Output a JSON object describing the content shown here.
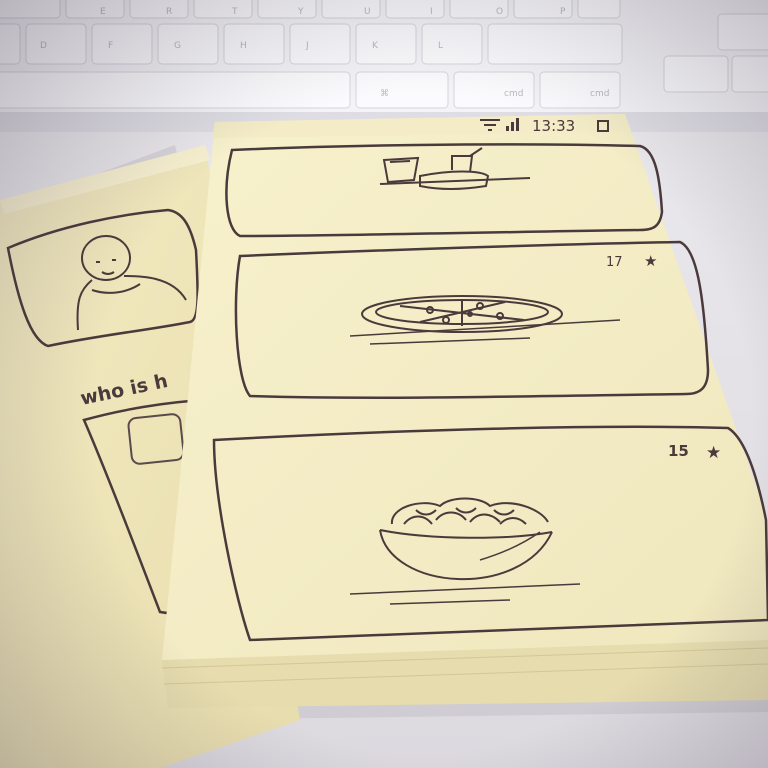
{
  "status_bar": {
    "time": "13:33"
  },
  "back_note": {
    "caption": "who is h"
  },
  "front_note": {
    "cards": [
      {
        "rating": "",
        "subject": "drink-and-cake"
      },
      {
        "rating": "17",
        "subject": "pizza"
      },
      {
        "rating": "15",
        "subject": "salad-bowl"
      }
    ]
  },
  "colors": {
    "paper": "#f6efc6",
    "paper_shadow": "#ddd3a6",
    "ink": "#4a3a3c",
    "keyboard": "#f2f2f5",
    "desk": "#e4e2e6"
  },
  "icons": [
    "wifi-icon",
    "signal-icon",
    "battery-icon",
    "star-icon",
    "person-icon"
  ]
}
